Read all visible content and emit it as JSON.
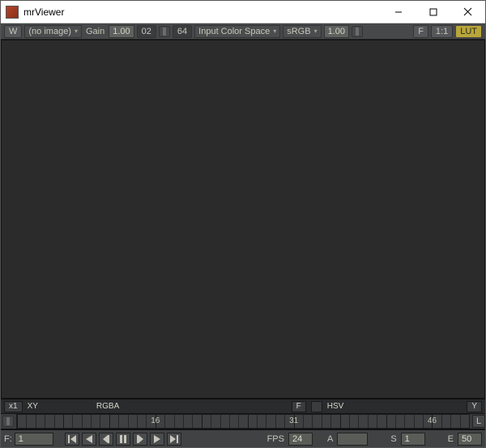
{
  "window": {
    "title": "mrViewer"
  },
  "topbar": {
    "w_btn": "W",
    "image_name": "(no image)",
    "gain_label": "Gain",
    "gain_value": "1.00",
    "stop_a": "02",
    "stop_b": "64",
    "ics_label": "Input Color Space",
    "ics_value": "sRGB",
    "gamma_value": "1.00",
    "f_btn": "F",
    "ratio_btn": "1:1",
    "lut_btn": "LUT"
  },
  "status": {
    "zoom": "x1",
    "coord_mode": "XY",
    "chan_mode": "RGBA",
    "f_indicator": "F",
    "color_mode": "HSV",
    "y_indicator": "Y"
  },
  "timeline": {
    "marks": [
      "16",
      "31",
      "46"
    ],
    "l_btn": "L"
  },
  "transport": {
    "f_label": "F:",
    "f_value": "1",
    "fps_label": "FPS",
    "fps_value": "24",
    "a_label": "A",
    "s_label": "S",
    "s_value": "1",
    "e_label": "E",
    "e_value": "50"
  }
}
